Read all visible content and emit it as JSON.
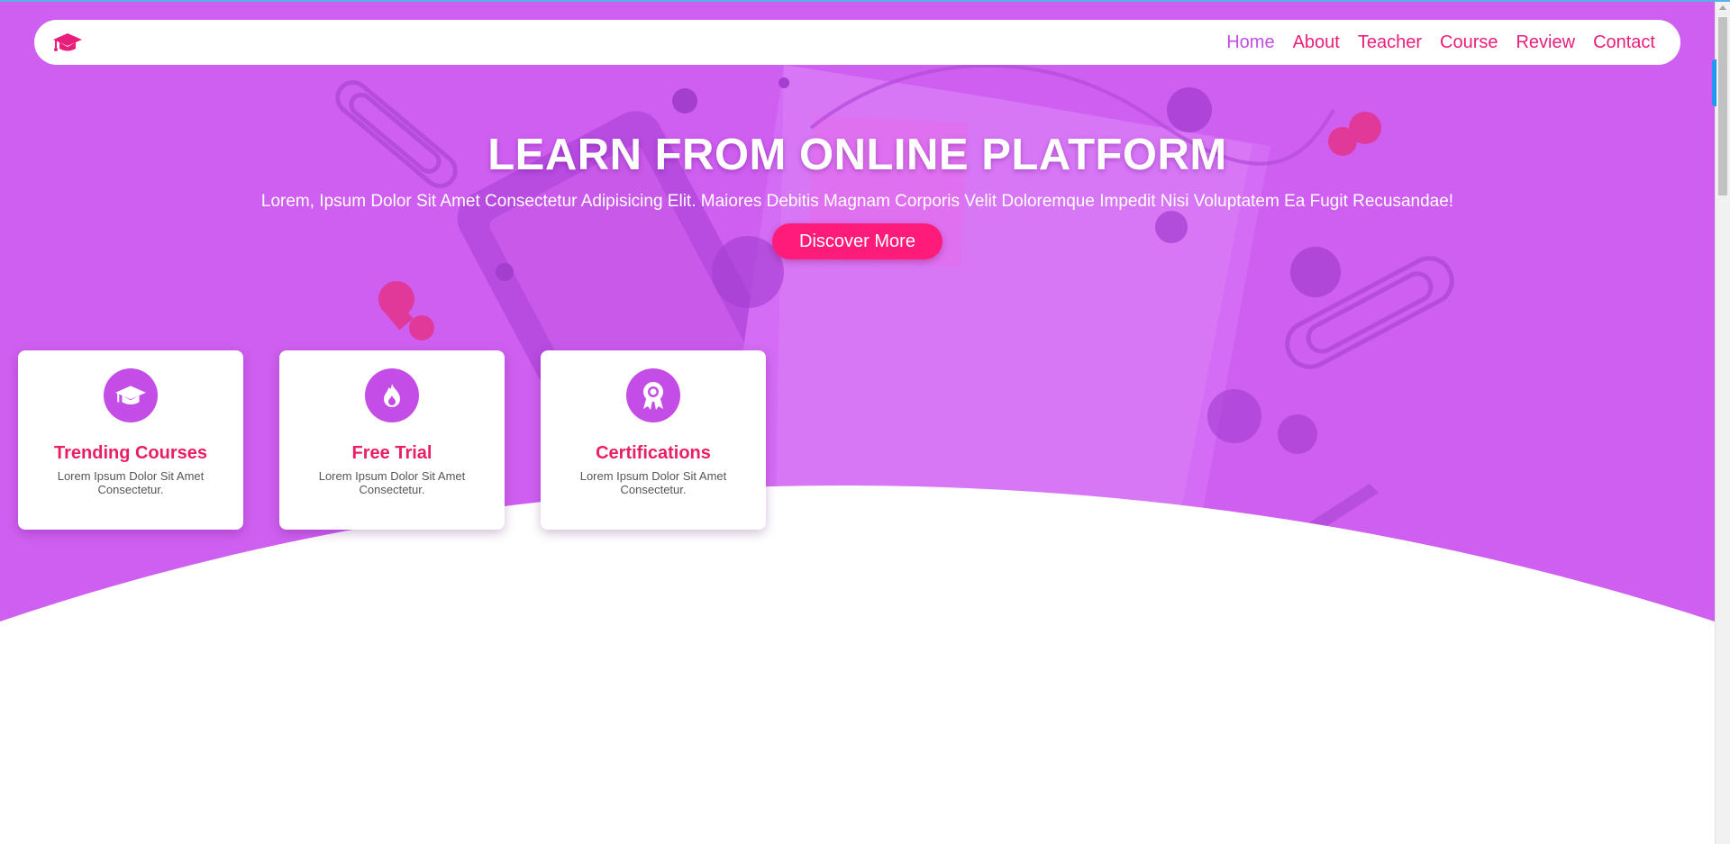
{
  "navbar": {
    "logo_icon": "graduation-cap-icon",
    "links": [
      {
        "label": "Home",
        "active": true
      },
      {
        "label": "About",
        "active": false
      },
      {
        "label": "Teacher",
        "active": false
      },
      {
        "label": "Course",
        "active": false
      },
      {
        "label": "Review",
        "active": false
      },
      {
        "label": "Contact",
        "active": false
      }
    ]
  },
  "hero": {
    "title": "LEARN FROM ONLINE PLATFORM",
    "subtitle": "Lorem, Ipsum Dolor Sit Amet Consectetur Adipisicing Elit. Maiores Debitis Magnam Corporis Velit Doloremque Impedit Nisi Voluptatem Ea Fugit Recusandae!",
    "button_label": "Discover More"
  },
  "features": [
    {
      "icon": "graduation-cap-icon",
      "title": "Trending Courses",
      "desc": "Lorem Ipsum Dolor Sit Amet Consectetur."
    },
    {
      "icon": "fire-icon",
      "title": "Free Trial",
      "desc": "Lorem Ipsum Dolor Sit Amet Consectetur."
    },
    {
      "icon": "award-icon",
      "title": "Certifications",
      "desc": "Lorem Ipsum Dolor Sit Amet Consectetur."
    }
  ],
  "colors": {
    "hero_bg": "#cf5ff0",
    "accent_pink": "#e91e63",
    "button_pink": "#ff1b7a",
    "icon_purple": "#c44de8"
  }
}
